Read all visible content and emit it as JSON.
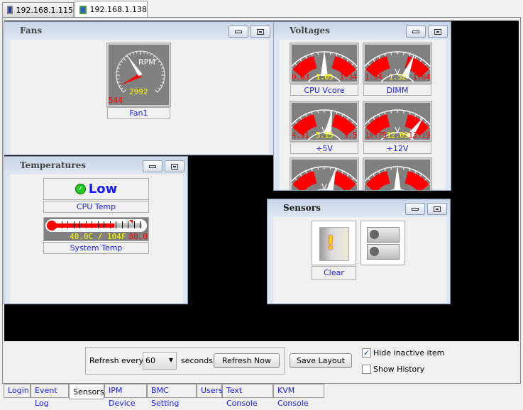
{
  "top_tabs": [
    {
      "label": "192.168.1.115"
    },
    {
      "label": "192.168.1.138",
      "active": true
    }
  ],
  "fans": {
    "title": "Fans",
    "gauges": [
      {
        "label": "Fan1",
        "unit": "RPM",
        "min": "544",
        "value": "2992",
        "min_num": 544,
        "value_num": 2992,
        "scale_max": 8000
      }
    ]
  },
  "voltages": {
    "title": "Voltages",
    "gauges": [
      {
        "label": "CPU Vcore",
        "min": "0.83",
        "value": "1.05",
        "max": "1.34",
        "fraction": 0.5,
        "unit": "V"
      },
      {
        "label": "DIMM",
        "min": "1.34",
        "value": "1.52",
        "max": "1.64",
        "fraction": 0.72,
        "unit": "V"
      },
      {
        "label": "+5V",
        "min": "4.51",
        "value": "5.15",
        "max": "5.5",
        "fraction": 0.6,
        "unit": "V"
      },
      {
        "label": "+12V",
        "min": "10.75",
        "value": "12.03",
        "max": "13.19",
        "fraction": 0.85,
        "unit": "V"
      },
      {
        "label": "",
        "min": "",
        "value": "",
        "max": "",
        "fraction": 0.65,
        "unit": "V"
      },
      {
        "label": "",
        "min": "",
        "value": "",
        "max": "",
        "fraction": 0.5,
        "unit": "V"
      }
    ]
  },
  "temperatures": {
    "title": "Temperatures",
    "cpu": {
      "status": "Low",
      "label": "CPU Temp"
    },
    "system": {
      "reading": "40.0C / 104F",
      "limit": "80.0",
      "label": "System Temp",
      "fraction": 0.68,
      "limit_fraction": 0.85
    }
  },
  "sensors": {
    "title": "Sensors",
    "items": [
      {
        "label": "Clear",
        "icon": "chassis-intrusion-icon"
      },
      {
        "label": "",
        "icon": "power-supply-icon"
      }
    ]
  },
  "controls": {
    "refresh_label": "Refresh every",
    "interval": "60",
    "seconds_label": "seconds",
    "refresh_now": "Refresh Now",
    "save_layout": "Save Layout",
    "hide_inactive": "Hide inactive item",
    "hide_inactive_checked": true,
    "show_history": "Show History",
    "show_history_checked": false
  },
  "bottom_tabs": [
    {
      "label": "Login"
    },
    {
      "label": "Event Log"
    },
    {
      "label": "Sensors",
      "active": true
    },
    {
      "label": "IPM Device"
    },
    {
      "label": "BMC Setting"
    },
    {
      "label": "Users"
    },
    {
      "label": "Text Console"
    },
    {
      "label": "KVM Console"
    }
  ]
}
